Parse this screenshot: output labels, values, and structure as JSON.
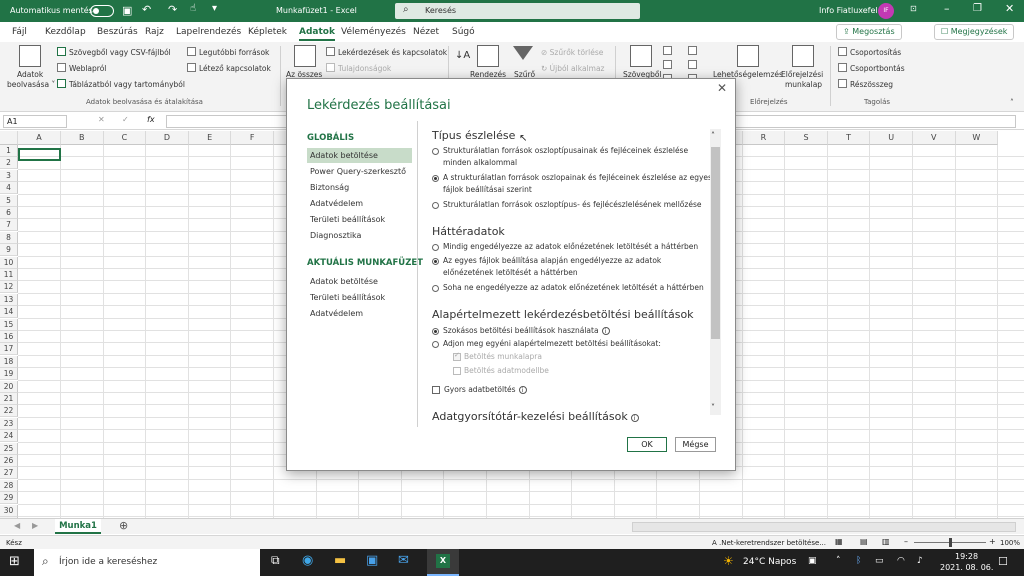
{
  "titlebar": {
    "autosave_label": "Automatikus mentés",
    "file_title": "Munkafüzet1 - Excel",
    "search_placeholder": "Keresés",
    "user_name": "Info Fiatluxefel",
    "user_initials": "IF"
  },
  "tabs": [
    "Fájl",
    "Kezdőlap",
    "Beszúrás",
    "Rajz",
    "Lapelrendezés",
    "Képletek",
    "Adatok",
    "Véleményezés",
    "Nézet",
    "Súgó"
  ],
  "active_tab": "Adatok",
  "share_label": "Megosztás",
  "comments_label": "Megjegyzések",
  "ribbon": {
    "get_data_l1": "Adatok",
    "get_data_l2": "beolvasása ˅",
    "from_text_csv": "Szövegből vagy CSV-fájlból",
    "from_web": "Weblapról",
    "from_table": "Táblázatból vagy tartományból",
    "recent_sources": "Legutóbbi források",
    "existing_connections": "Létező kapcsolatok",
    "group_get_data": "Adatok beolvasása és átalakítása",
    "refresh_all": "Az összes",
    "queries_connections": "Lekérdezések és kapcsolatok",
    "properties": "Tulajdonságok",
    "sort": "Rendezés",
    "filter": "Szűrő",
    "clear_filters": "Szűrők törlése",
    "reapply": "Újból alkalmaz",
    "text_to_columns": "Szövegből",
    "what_if": "Lehetőségelemzés",
    "forecast_l1": "Előrejelzési",
    "forecast_l2": "munkalap",
    "group_forecast": "Előrejelzés",
    "group_outline": "Tagolás",
    "group": "Csoportosítás",
    "ungroup": "Csoportbontás",
    "subtotal": "Részösszeg"
  },
  "formula_bar": {
    "name_box": "A1",
    "fx": "fx"
  },
  "columns": [
    "A",
    "B",
    "C",
    "D",
    "E",
    "F",
    "G",
    "H",
    "I",
    "J",
    "K",
    "L",
    "M",
    "N",
    "O",
    "P",
    "Q",
    "R",
    "S",
    "T",
    "U",
    "V",
    "W"
  ],
  "rows": [
    "1",
    "2",
    "3",
    "4",
    "5",
    "6",
    "7",
    "8",
    "9",
    "10",
    "11",
    "12",
    "13",
    "14",
    "15",
    "16",
    "17",
    "18",
    "19",
    "20",
    "21",
    "22",
    "23",
    "24",
    "25",
    "26",
    "27",
    "28",
    "29",
    "30",
    "31"
  ],
  "sheet_tab": "Munka1",
  "statusbar": {
    "ready": "Kész",
    "loading": "A .Net-keretrendszer betöltése...",
    "zoom": "100%"
  },
  "taskbar": {
    "search_placeholder": "Írjon ide a kereséshez",
    "weather": "24°C  Napos",
    "time": "19:28",
    "date": "2021. 08. 06."
  },
  "dialog": {
    "title": "Lekérdezés beállításai",
    "global_header": "GLOBÁLIS",
    "global_items": [
      "Adatok betöltése",
      "Power Query-szerkesztő",
      "Biztonság",
      "Adatvédelem",
      "Területi beállítások",
      "Diagnosztika"
    ],
    "current_header": "AKTUÁLIS MUNKAFÜZET",
    "current_items": [
      "Adatok betöltése",
      "Területi beállítások",
      "Adatvédelem"
    ],
    "type_detection": {
      "heading": "Típus észlelése",
      "opt1_l1": "Strukturálatlan források oszloptípusainak és fejléceinek észlelése",
      "opt1_l2": "minden alkalommal",
      "opt2_l1": "A strukturálatlan források oszlopainak és fejléceinek észlelése az egyes",
      "opt2_l2": "fájlok beállításai szerint",
      "opt3": "Strukturálatlan források oszloptípus- és fejlécészlelésének mellőzése"
    },
    "background_data": {
      "heading": "Háttéradatok",
      "opt1": "Mindig engedélyezze az adatok előnézetének letöltését a háttérben",
      "opt2_l1": "Az egyes fájlok beállítása alapján engedélyezze az adatok",
      "opt2_l2": "előnézetének letöltését a háttérben",
      "opt3": "Soha ne engedélyezze az adatok előnézetének letöltését a háttérben"
    },
    "default_load": {
      "heading": "Alapértelmezett lekérdezésbetöltési beállítások",
      "opt1": "Szokásos betöltési beállítások használata",
      "opt2": "Adjon meg egyéni alapértelmezett betöltési beállításokat:",
      "chk1": "Betöltés munkalapra",
      "chk2": "Betöltés adatmodellbe"
    },
    "fast_load": "Gyors adatbetöltés",
    "cache_heading": "Adatgyorsítótár-kezelési beállítások",
    "ok": "OK",
    "cancel": "Mégse"
  },
  "colors": {
    "excel_green": "#217346",
    "nav_selected": "#c8dcc9"
  }
}
